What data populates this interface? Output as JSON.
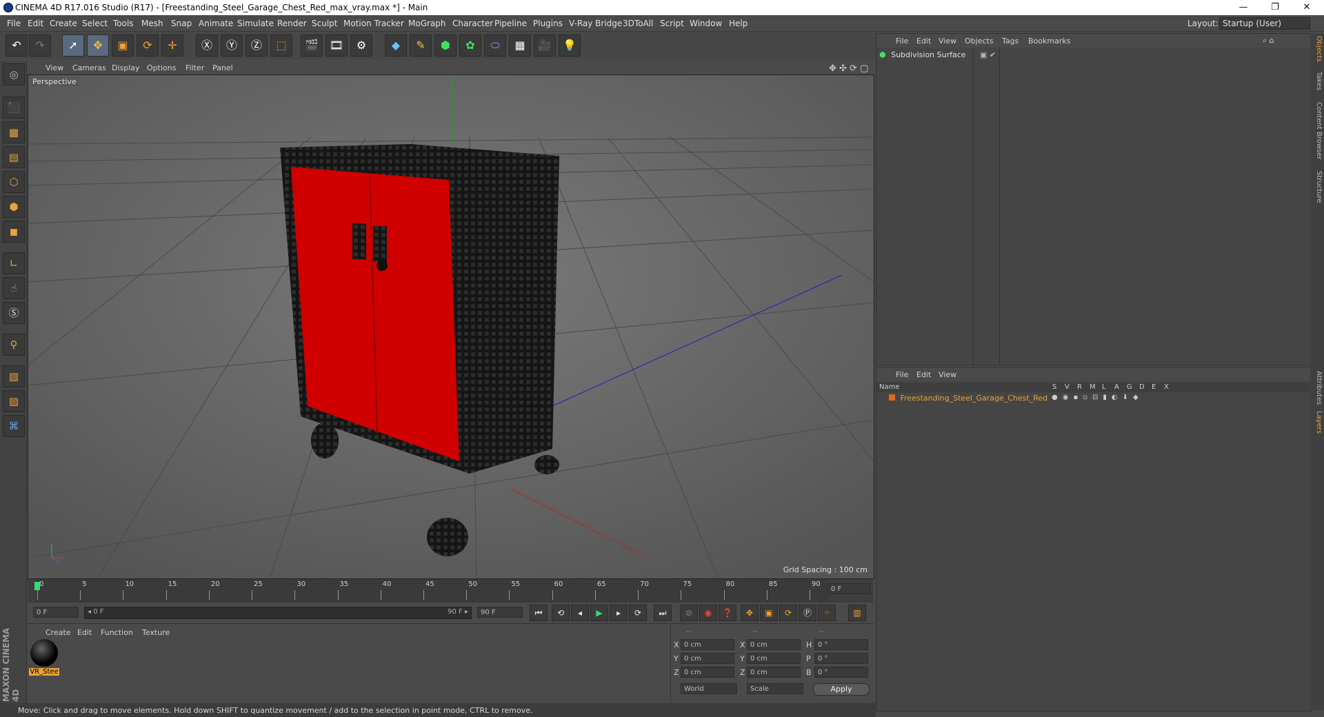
{
  "window": {
    "title": "CINEMA 4D R17.016 Studio (R17) - [Freestanding_Steel_Garage_Chest_Red_max_vray.max *] - Main",
    "buttons": {
      "minimize": "—",
      "maximize": "❐",
      "close": "✕"
    }
  },
  "menubar": {
    "items": [
      "File",
      "Edit",
      "Create",
      "Select",
      "Tools",
      "Mesh",
      "Snap",
      "Animate",
      "Simulate",
      "Render",
      "Sculpt",
      "Motion Tracker",
      "MoGraph",
      "Character",
      "Pipeline",
      "Plugins",
      "V-Ray Bridge",
      "3DToAll",
      "Script",
      "Window",
      "Help"
    ],
    "layout_label": "Layout:",
    "layout_value": "Startup (User)"
  },
  "viewport": {
    "menu": [
      "View",
      "Cameras",
      "Display",
      "Options",
      "Filter",
      "Panel"
    ],
    "camera_label": "Perspective",
    "grid_spacing": "Grid Spacing : 100 cm"
  },
  "timeline": {
    "ticks": [
      "0",
      "5",
      "10",
      "15",
      "20",
      "25",
      "30",
      "35",
      "40",
      "45",
      "50",
      "55",
      "60",
      "65",
      "70",
      "75",
      "80",
      "85",
      "90"
    ],
    "current_frame": "0 F",
    "start_field": "0 F",
    "range_start": "◂ 0 F",
    "range_end": "90 F ▸",
    "end_field": "90 F"
  },
  "materials": {
    "menu": [
      "Create",
      "Edit",
      "Function",
      "Texture"
    ],
    "items": [
      {
        "name": "VR_Stee"
      }
    ]
  },
  "coordinates": {
    "headers": [
      "--",
      "--",
      "--"
    ],
    "rows": [
      {
        "a_label": "X",
        "a_val": "0 cm",
        "b_label": "X",
        "b_val": "0 cm",
        "c_label": "H",
        "c_val": "0 °"
      },
      {
        "a_label": "Y",
        "a_val": "0 cm",
        "b_label": "Y",
        "b_val": "0 cm",
        "c_label": "P",
        "c_val": "0 °"
      },
      {
        "a_label": "Z",
        "a_val": "0 cm",
        "b_label": "Z",
        "b_val": "0 cm",
        "c_label": "B",
        "c_val": "0 °"
      }
    ],
    "mode": "World",
    "scale": "Scale",
    "apply": "Apply"
  },
  "objects_panel": {
    "menu": [
      "File",
      "Edit",
      "View",
      "Objects",
      "Tags",
      "Bookmarks"
    ],
    "items": [
      {
        "name": "Subdivision Surface"
      }
    ]
  },
  "layers_panel": {
    "menu": [
      "File",
      "Edit",
      "View"
    ],
    "column_name": "Name",
    "columns": [
      "S",
      "V",
      "R",
      "M",
      "L",
      "A",
      "G",
      "D",
      "E",
      "X"
    ],
    "items": [
      {
        "name": "Freestanding_Steel_Garage_Chest_Red",
        "color": "#e0661b"
      }
    ]
  },
  "sidetabs": [
    "Objects",
    "Takes",
    "Content Browser",
    "Structure",
    "Attributes",
    "Layers"
  ],
  "brand": "MAXON CINEMA 4D",
  "status": "Move: Click and drag to move elements. Hold down SHIFT to quantize movement / add to the selection in point mode, CTRL to remove.",
  "colors": {
    "accent": "#e8a33a",
    "door_red": "#d10000",
    "selected_layer": "#e8a33a"
  }
}
